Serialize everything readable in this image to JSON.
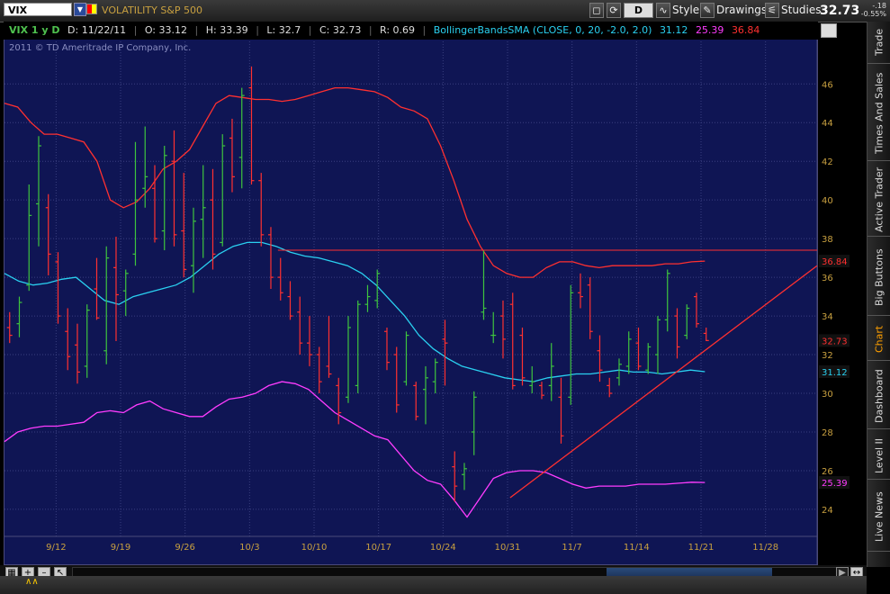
{
  "toolbar": {
    "symbol": "VIX",
    "company": "VOLATILITY S&P 500",
    "aggregation": "D",
    "style_label": "Style",
    "drawings_label": "Drawings",
    "studies_label": "Studies",
    "last_price": "32.73",
    "net_change": "-.18",
    "pct_change": "-0.55%"
  },
  "infobar": {
    "period": "VIX 1 y D",
    "date": "D: 11/22/11",
    "open": "O: 33.12",
    "high": "H: 33.39",
    "low": "L: 32.7",
    "close": "C: 32.73",
    "range": "R: 0.69",
    "study": "BollingerBandsSMA (CLOSE, 0, 20, -2.0, 2.0)",
    "mid": "31.12",
    "lower": "25.39",
    "upper": "36.84"
  },
  "copyright": "2011 © TD Ameritrade IP Company, Inc.",
  "side_tabs": [
    "Trade",
    "Times And Sales",
    "Active Trader",
    "Big Buttons",
    "Chart",
    "Dashboard",
    "Level II",
    "Live News"
  ],
  "active_tab": "Chart",
  "colors": {
    "background": "#0f1554",
    "up": "#3ec43e",
    "down": "#ff3030",
    "mid_band": "#2ad0f0",
    "lower_band": "#ff3cff",
    "upper_band": "#ff3030",
    "grid": "#3a3f80",
    "axis_text": "#c8a040"
  },
  "chart_data": {
    "type": "ohlc",
    "ylim": [
      22.6,
      48.2
    ],
    "yticks": [
      24,
      26,
      28,
      30,
      32,
      34,
      36,
      38,
      40,
      42,
      44,
      46
    ],
    "xticks": [
      {
        "label": "9/12",
        "day": 10
      },
      {
        "label": "9/19",
        "day": 15
      },
      {
        "label": "9/26",
        "day": 20
      },
      {
        "label": "10/3",
        "day": 25
      },
      {
        "label": "10/10",
        "day": 30
      },
      {
        "label": "10/17",
        "day": 35
      },
      {
        "label": "10/24",
        "day": 40
      },
      {
        "label": "10/31",
        "day": 45
      },
      {
        "label": "11/7",
        "day": 50
      },
      {
        "label": "11/14",
        "day": 55
      },
      {
        "label": "11/21",
        "day": 60
      },
      {
        "label": "11/28",
        "day": 65
      }
    ],
    "xlim": [
      6,
      69
    ],
    "grid": true,
    "bars": [
      {
        "o": 33.4,
        "h": 34.2,
        "l": 32.6,
        "c": 33.0
      },
      {
        "o": 33.6,
        "h": 35.0,
        "l": 32.9,
        "c": 34.7
      },
      {
        "o": 35.6,
        "h": 40.8,
        "l": 35.3,
        "c": 39.2
      },
      {
        "o": 39.8,
        "h": 43.3,
        "l": 37.6,
        "c": 42.8
      },
      {
        "o": 39.6,
        "h": 40.3,
        "l": 36.1,
        "c": 37.2
      },
      {
        "o": 36.8,
        "h": 37.3,
        "l": 33.6,
        "c": 34.0
      },
      {
        "o": 33.2,
        "h": 34.4,
        "l": 31.2,
        "c": 31.9
      },
      {
        "o": 32.5,
        "h": 33.6,
        "l": 30.5,
        "c": 31.1
      },
      {
        "o": 31.4,
        "h": 34.6,
        "l": 30.8,
        "c": 34.3
      },
      {
        "o": 35.4,
        "h": 37.0,
        "l": 33.8,
        "c": 33.9
      },
      {
        "o": 32.2,
        "h": 37.6,
        "l": 31.5,
        "c": 37.0
      },
      {
        "o": 36.5,
        "h": 38.1,
        "l": 32.7,
        "c": 35.1
      },
      {
        "o": 35.3,
        "h": 36.4,
        "l": 34.0,
        "c": 36.2
      },
      {
        "o": 37.2,
        "h": 43.0,
        "l": 36.6,
        "c": 40.0
      },
      {
        "o": 40.6,
        "h": 43.8,
        "l": 39.6,
        "c": 41.2
      },
      {
        "o": 40.6,
        "h": 41.8,
        "l": 37.8,
        "c": 38.0
      },
      {
        "o": 38.4,
        "h": 42.8,
        "l": 37.4,
        "c": 42.3
      },
      {
        "o": 42.0,
        "h": 43.6,
        "l": 37.6,
        "c": 38.2
      },
      {
        "o": 38.4,
        "h": 41.4,
        "l": 36.0,
        "c": 36.4
      },
      {
        "o": 36.6,
        "h": 39.6,
        "l": 35.2,
        "c": 38.9
      },
      {
        "o": 39.0,
        "h": 41.8,
        "l": 37.0,
        "c": 39.6
      },
      {
        "o": 40.0,
        "h": 41.6,
        "l": 36.4,
        "c": 37.2
      },
      {
        "o": 37.8,
        "h": 43.4,
        "l": 37.6,
        "c": 42.8
      },
      {
        "o": 43.2,
        "h": 44.2,
        "l": 40.4,
        "c": 41.2
      },
      {
        "o": 42.2,
        "h": 45.8,
        "l": 40.6,
        "c": 45.4
      },
      {
        "o": 45.8,
        "h": 46.9,
        "l": 40.8,
        "c": 41.0
      },
      {
        "o": 41.0,
        "h": 41.4,
        "l": 37.6,
        "c": 38.2
      },
      {
        "o": 38.2,
        "h": 38.6,
        "l": 35.4,
        "c": 36.0
      },
      {
        "o": 36.0,
        "h": 37.0,
        "l": 34.8,
        "c": 35.2
      },
      {
        "o": 35.0,
        "h": 35.8,
        "l": 33.8,
        "c": 34.0
      },
      {
        "o": 34.2,
        "h": 35.0,
        "l": 32.0,
        "c": 32.6
      },
      {
        "o": 32.6,
        "h": 34.0,
        "l": 31.4,
        "c": 32.0
      },
      {
        "o": 32.0,
        "h": 32.4,
        "l": 30.0,
        "c": 30.6
      },
      {
        "o": 31.4,
        "h": 34.0,
        "l": 30.8,
        "c": 31.0
      },
      {
        "o": 30.4,
        "h": 30.8,
        "l": 28.4,
        "c": 29.0
      },
      {
        "o": 29.8,
        "h": 34.0,
        "l": 29.5,
        "c": 33.4
      },
      {
        "o": 30.4,
        "h": 34.8,
        "l": 30.0,
        "c": 34.6
      },
      {
        "o": 34.6,
        "h": 35.6,
        "l": 34.2,
        "c": 35.0
      },
      {
        "o": 34.8,
        "h": 36.4,
        "l": 34.4,
        "c": 36.2
      },
      {
        "o": 33.2,
        "h": 33.4,
        "l": 31.2,
        "c": 31.6
      },
      {
        "o": 32.0,
        "h": 32.4,
        "l": 29.0,
        "c": 29.4
      },
      {
        "o": 30.6,
        "h": 33.2,
        "l": 30.4,
        "c": 33.0
      },
      {
        "o": 30.4,
        "h": 30.6,
        "l": 28.6,
        "c": 28.8
      },
      {
        "o": 30.2,
        "h": 31.4,
        "l": 28.4,
        "c": 30.8
      },
      {
        "o": 30.6,
        "h": 31.8,
        "l": 30.0,
        "c": 31.6
      },
      {
        "o": 32.8,
        "h": 33.8,
        "l": 30.4,
        "c": 32.6
      },
      {
        "o": 26.2,
        "h": 27.0,
        "l": 24.4,
        "c": 25.2
      },
      {
        "o": 25.8,
        "h": 26.4,
        "l": 25.0,
        "c": 26.1
      },
      {
        "o": 28.0,
        "h": 30.1,
        "l": 26.8,
        "c": 29.8
      },
      {
        "o": 34.2,
        "h": 37.4,
        "l": 33.8,
        "c": 34.4
      },
      {
        "o": 33.0,
        "h": 34.2,
        "l": 32.6,
        "c": 33.0
      },
      {
        "o": 34.0,
        "h": 34.8,
        "l": 31.8,
        "c": 32.8
      },
      {
        "o": 34.6,
        "h": 35.2,
        "l": 30.2,
        "c": 30.4
      },
      {
        "o": 33.0,
        "h": 33.4,
        "l": 30.4,
        "c": 30.8
      },
      {
        "o": 30.4,
        "h": 31.4,
        "l": 30.0,
        "c": 30.6
      },
      {
        "o": 30.4,
        "h": 30.6,
        "l": 29.7,
        "c": 29.9
      },
      {
        "o": 30.4,
        "h": 32.6,
        "l": 29.6,
        "c": 31.4
      },
      {
        "o": 29.8,
        "h": 30.8,
        "l": 27.4,
        "c": 27.8
      },
      {
        "o": 29.8,
        "h": 35.6,
        "l": 29.4,
        "c": 35.2
      },
      {
        "o": 35.2,
        "h": 36.2,
        "l": 34.4,
        "c": 35.0
      },
      {
        "o": 35.6,
        "h": 36.0,
        "l": 32.8,
        "c": 33.2
      },
      {
        "o": 32.2,
        "h": 33.0,
        "l": 30.6,
        "c": 31.2
      },
      {
        "o": 30.4,
        "h": 30.8,
        "l": 29.8,
        "c": 30.0
      },
      {
        "o": 30.8,
        "h": 31.8,
        "l": 30.4,
        "c": 31.5
      },
      {
        "o": 31.4,
        "h": 33.2,
        "l": 31.0,
        "c": 32.8
      },
      {
        "o": 32.6,
        "h": 33.4,
        "l": 31.2,
        "c": 31.4
      },
      {
        "o": 31.2,
        "h": 32.6,
        "l": 31.0,
        "c": 32.4
      },
      {
        "o": 32.0,
        "h": 34.0,
        "l": 31.0,
        "c": 33.8
      },
      {
        "o": 33.8,
        "h": 36.4,
        "l": 33.2,
        "c": 36.2
      },
      {
        "o": 34.0,
        "h": 34.4,
        "l": 31.8,
        "c": 32.4
      },
      {
        "o": 33.0,
        "h": 34.6,
        "l": 32.8,
        "c": 34.4
      },
      {
        "o": 35.0,
        "h": 35.2,
        "l": 33.4,
        "c": 33.6
      },
      {
        "o": 33.1,
        "h": 33.4,
        "l": 32.7,
        "c": 32.73
      }
    ],
    "bands": {
      "upper": [
        45.0,
        44.8,
        44.0,
        43.4,
        43.4,
        43.2,
        43.0,
        42.0,
        40.0,
        39.6,
        39.9,
        40.6,
        41.6,
        42.0,
        42.6,
        43.8,
        45.0,
        45.4,
        45.3,
        45.2,
        45.2,
        45.1,
        45.2,
        45.4,
        45.6,
        45.8,
        45.8,
        45.7,
        45.6,
        45.3,
        44.8,
        44.6,
        44.2,
        42.8,
        41.0,
        39.0,
        37.6,
        36.6,
        36.2,
        36.0,
        36.0,
        36.5,
        36.8,
        36.8,
        36.6,
        36.5,
        36.6,
        36.6,
        36.6,
        36.6,
        36.7,
        36.7,
        36.8,
        36.84
      ],
      "mid": [
        36.2,
        35.8,
        35.6,
        35.7,
        35.9,
        36.0,
        35.4,
        34.8,
        34.6,
        35.0,
        35.2,
        35.4,
        35.6,
        36.0,
        36.6,
        37.2,
        37.6,
        37.8,
        37.8,
        37.6,
        37.3,
        37.1,
        37.0,
        36.8,
        36.6,
        36.2,
        35.6,
        34.8,
        34.0,
        33.0,
        32.3,
        31.8,
        31.4,
        31.2,
        31.0,
        30.8,
        30.7,
        30.6,
        30.8,
        30.9,
        31.0,
        31.0,
        31.1,
        31.2,
        31.1,
        31.1,
        31.0,
        31.1,
        31.2,
        31.12
      ],
      "lower": [
        27.5,
        28.0,
        28.2,
        28.3,
        28.3,
        28.4,
        28.5,
        29.0,
        29.1,
        29.0,
        29.4,
        29.6,
        29.2,
        29.0,
        28.8,
        28.8,
        29.3,
        29.7,
        29.8,
        30.0,
        30.4,
        30.6,
        30.5,
        30.2,
        29.6,
        29.0,
        28.6,
        28.2,
        27.8,
        27.6,
        26.8,
        26.0,
        25.5,
        25.3,
        24.5,
        23.6,
        24.6,
        25.6,
        25.9,
        26.0,
        26.0,
        25.9,
        25.6,
        25.3,
        25.1,
        25.2,
        25.2,
        25.2,
        25.3,
        25.3,
        25.3,
        25.35,
        25.4,
        25.39
      ]
    },
    "horizontal_line": 37.4,
    "trendline": {
      "from": [
        45.2,
        24.6
      ],
      "to": [
        69,
        36.6
      ]
    },
    "price_labels": [
      {
        "value": 36.84,
        "text": "36.84",
        "color": "#ff3030"
      },
      {
        "value": 32.73,
        "text": "32.73",
        "color": "#ff3030"
      },
      {
        "value": 31.12,
        "text": "31.12",
        "color": "#2ad0f0"
      },
      {
        "value": 25.39,
        "text": "25.39",
        "color": "#ff3cff"
      }
    ]
  }
}
